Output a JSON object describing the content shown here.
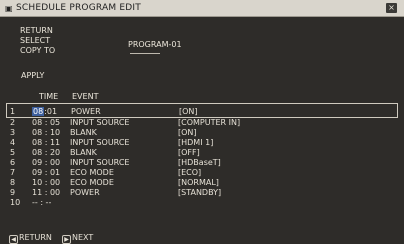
{
  "title": "SCHEDULE PROGRAM EDIT",
  "close_glyph": "×",
  "menu": {
    "return_label": "RETURN",
    "select_label": "SELECT",
    "copy_label": "COPY TO",
    "apply_label": "APPLY",
    "program_name": "PROGRAM-01"
  },
  "columns": {
    "time": "TIME",
    "event": "EVENT"
  },
  "rows": [
    {
      "n": "1",
      "hour": "08",
      "minute": ":01",
      "event": "POWER",
      "value": "[ON]"
    },
    {
      "n": "2",
      "time": "08 : 05",
      "event": "INPUT SOURCE",
      "value": "[COMPUTER IN]"
    },
    {
      "n": "3",
      "time": "08 : 10",
      "event": "BLANK",
      "value": "[ON]"
    },
    {
      "n": "4",
      "time": "08 : 11",
      "event": "INPUT SOURCE",
      "value": "[HDMI 1]"
    },
    {
      "n": "5",
      "time": "08 : 20",
      "event": "BLANK",
      "value": "[OFF]"
    },
    {
      "n": "6",
      "time": "09 : 00",
      "event": "INPUT SOURCE",
      "value": "[HDBaseT]"
    },
    {
      "n": "7",
      "time": "09 : 01",
      "event": "ECO MODE",
      "value": "[ECO]"
    },
    {
      "n": "8",
      "time": "10 : 00",
      "event": "ECO MODE",
      "value": "[NORMAL]"
    },
    {
      "n": "9",
      "time": "11 : 00",
      "event": "POWER",
      "value": "[STANDBY]"
    },
    {
      "n": "10",
      "time": "-- : --",
      "event": "",
      "value": ""
    }
  ],
  "footer": {
    "return_label": "RETURN",
    "next_label": "NEXT"
  }
}
